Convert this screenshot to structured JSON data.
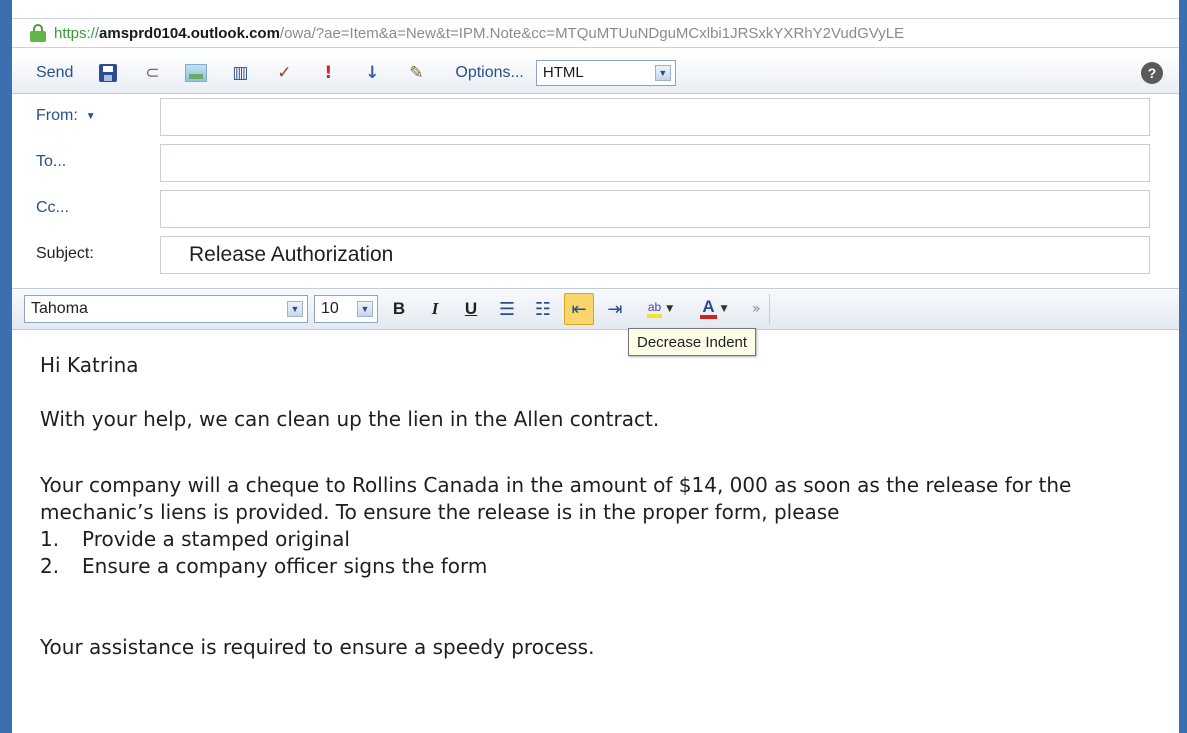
{
  "browser": {
    "url_protocol": "https://",
    "url_host": "amsprd0104.outlook.com",
    "url_path": "/owa/?ae=Item&a=New&t=IPM.Note&cc=MTQuMTUuNDguMCxlbi1JRSxkYXRhY2VudGVyLE"
  },
  "toolbar": {
    "send_label": "Send",
    "options_label": "Options...",
    "format_value": "HTML",
    "help_glyph": "?"
  },
  "header": {
    "from_label": "From:",
    "to_label": "To...",
    "cc_label": "Cc...",
    "subject_label": "Subject:",
    "from_value": "",
    "to_value": "",
    "cc_value": "",
    "subject_value": "Release Authorization"
  },
  "format_bar": {
    "font_value": "Tahoma",
    "size_value": "10",
    "bold_label": "B",
    "italic_label": "I",
    "underline_label": "U",
    "highlight_label": "ab",
    "font_color_label": "A",
    "active_button": "decrease-indent",
    "tooltip": "Decrease Indent"
  },
  "message": {
    "greeting": "Hi Katrina",
    "paragraph1": "With your help, we can clean up the lien in the Allen contract.",
    "paragraph2": "Your company will a cheque to Rollins Canada in the amount of $14, 000 as soon as the release for the mechanic’s liens is provided. To ensure the release is in the proper form, please",
    "list": [
      {
        "num": "1.",
        "text": "Provide a stamped original"
      },
      {
        "num": "2.",
        "text": "Ensure a company officer signs the form"
      }
    ],
    "closing": "Your assistance is required to ensure a speedy process."
  },
  "colors": {
    "accent_blue": "#2a4f8a",
    "window_edge": "#3b6fb0",
    "active_button": "#f9d66b",
    "lock_green": "#62b54a"
  },
  "icons": [
    "lock-icon",
    "save-icon",
    "attach-icon",
    "insert-image-icon",
    "address-book-icon",
    "check-names-icon",
    "high-importance-icon",
    "low-importance-icon",
    "signature-icon",
    "help-icon",
    "bullets-icon",
    "numbering-icon",
    "decrease-indent-icon",
    "increase-indent-icon",
    "highlight-icon",
    "font-color-icon",
    "more-icon"
  ]
}
